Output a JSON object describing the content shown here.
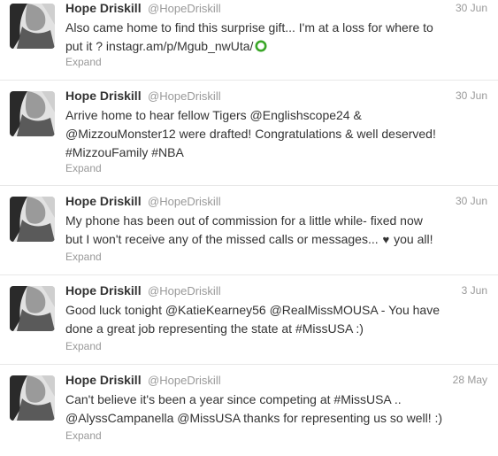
{
  "tweets": [
    {
      "fullname": "Hope Driskill",
      "username": "@HopeDriskill",
      "time": "30 Jun",
      "lines": [
        "Also came home to find this surprise gift... I'm at a loss for where to",
        "put it ? instagr.am/p/Mgub_nwUta/"
      ],
      "expand": "Expand"
    },
    {
      "fullname": "Hope Driskill",
      "username": "@HopeDriskill",
      "time": "30 Jun",
      "lines": [
        "Arrive home to hear fellow Tigers @Englishscope24 &",
        "@MizzouMonster12 were drafted! Congratulations & well deserved!",
        "#MizzouFamily #NBA"
      ],
      "expand": "Expand"
    },
    {
      "fullname": "Hope Driskill",
      "username": "@HopeDriskill",
      "time": "30 Jun",
      "lines": [
        "My phone has been out of commission for a little while- fixed now",
        "but I won't receive any of the missed calls or messages..."
      ],
      "line2_suffix": "you all!",
      "expand": "Expand"
    },
    {
      "fullname": "Hope Driskill",
      "username": "@HopeDriskill",
      "time": "3 Jun",
      "lines": [
        "Good luck tonight @KatieKearney56 @RealMissMOUSA - You have",
        "done a great job representing the state at #MissUSA :)"
      ],
      "expand": "Expand"
    },
    {
      "fullname": "Hope Driskill",
      "username": "@HopeDriskill",
      "time": "28 May",
      "lines": [
        "Can't believe it's been a year since competing at #MissUSA ..",
        "@AlyssCampanella @MissUSA thanks for representing us so well! :)"
      ],
      "expand": "Expand"
    }
  ],
  "icons": {
    "emoji": "green-ring-emoji-icon",
    "heart": "heart-icon"
  }
}
